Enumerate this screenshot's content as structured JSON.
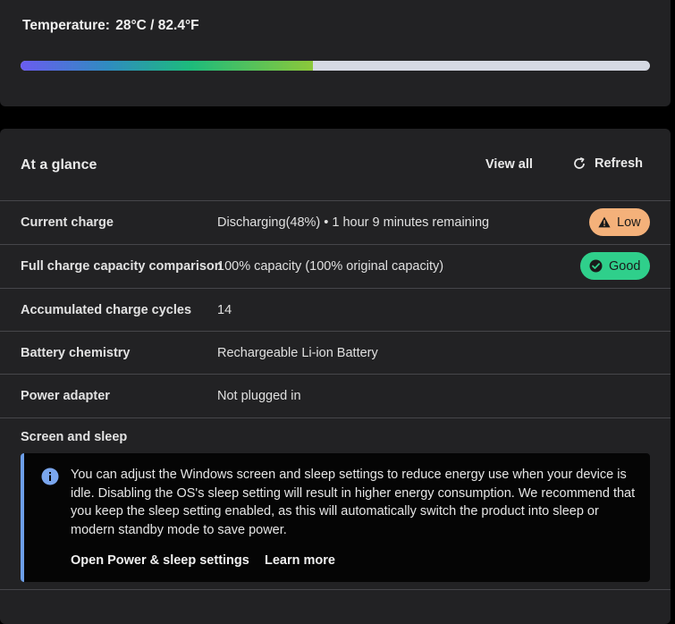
{
  "temperature": {
    "label": "Temperature:",
    "value": "28°C / 82.4°F",
    "level_fraction": 0.465
  },
  "glance": {
    "title": "At a glance",
    "view_all": "View all",
    "refresh": "Refresh",
    "rows": [
      {
        "key": "Current charge",
        "value": "Discharging(48%)  •  1 hour 9 minutes remaining",
        "badge": "Low"
      },
      {
        "key": "Full charge capacity comparison",
        "value": "100% capacity (100% original capacity)",
        "badge": "Good"
      },
      {
        "key": "Accumulated charge cycles",
        "value": "14"
      },
      {
        "key": "Battery chemistry",
        "value": "Rechargeable Li-ion Battery"
      },
      {
        "key": "Power adapter",
        "value": "Not plugged in"
      }
    ],
    "screen_sleep": {
      "title": "Screen and sleep",
      "message": "You can adjust the Windows screen and sleep settings to reduce energy use when your device is idle. Disabling the OS's sleep setting will result in higher energy consumption. We recommend that you keep the sleep setting enabled, as this will automatically switch the product into sleep or modern standby mode to save power.",
      "link_power": "Open Power & sleep settings",
      "link_learn": "Learn more"
    }
  },
  "colors": {
    "badge_low": "#f4b17a",
    "badge_good": "#2fcf8b",
    "info_accent": "#6c9ee8"
  }
}
